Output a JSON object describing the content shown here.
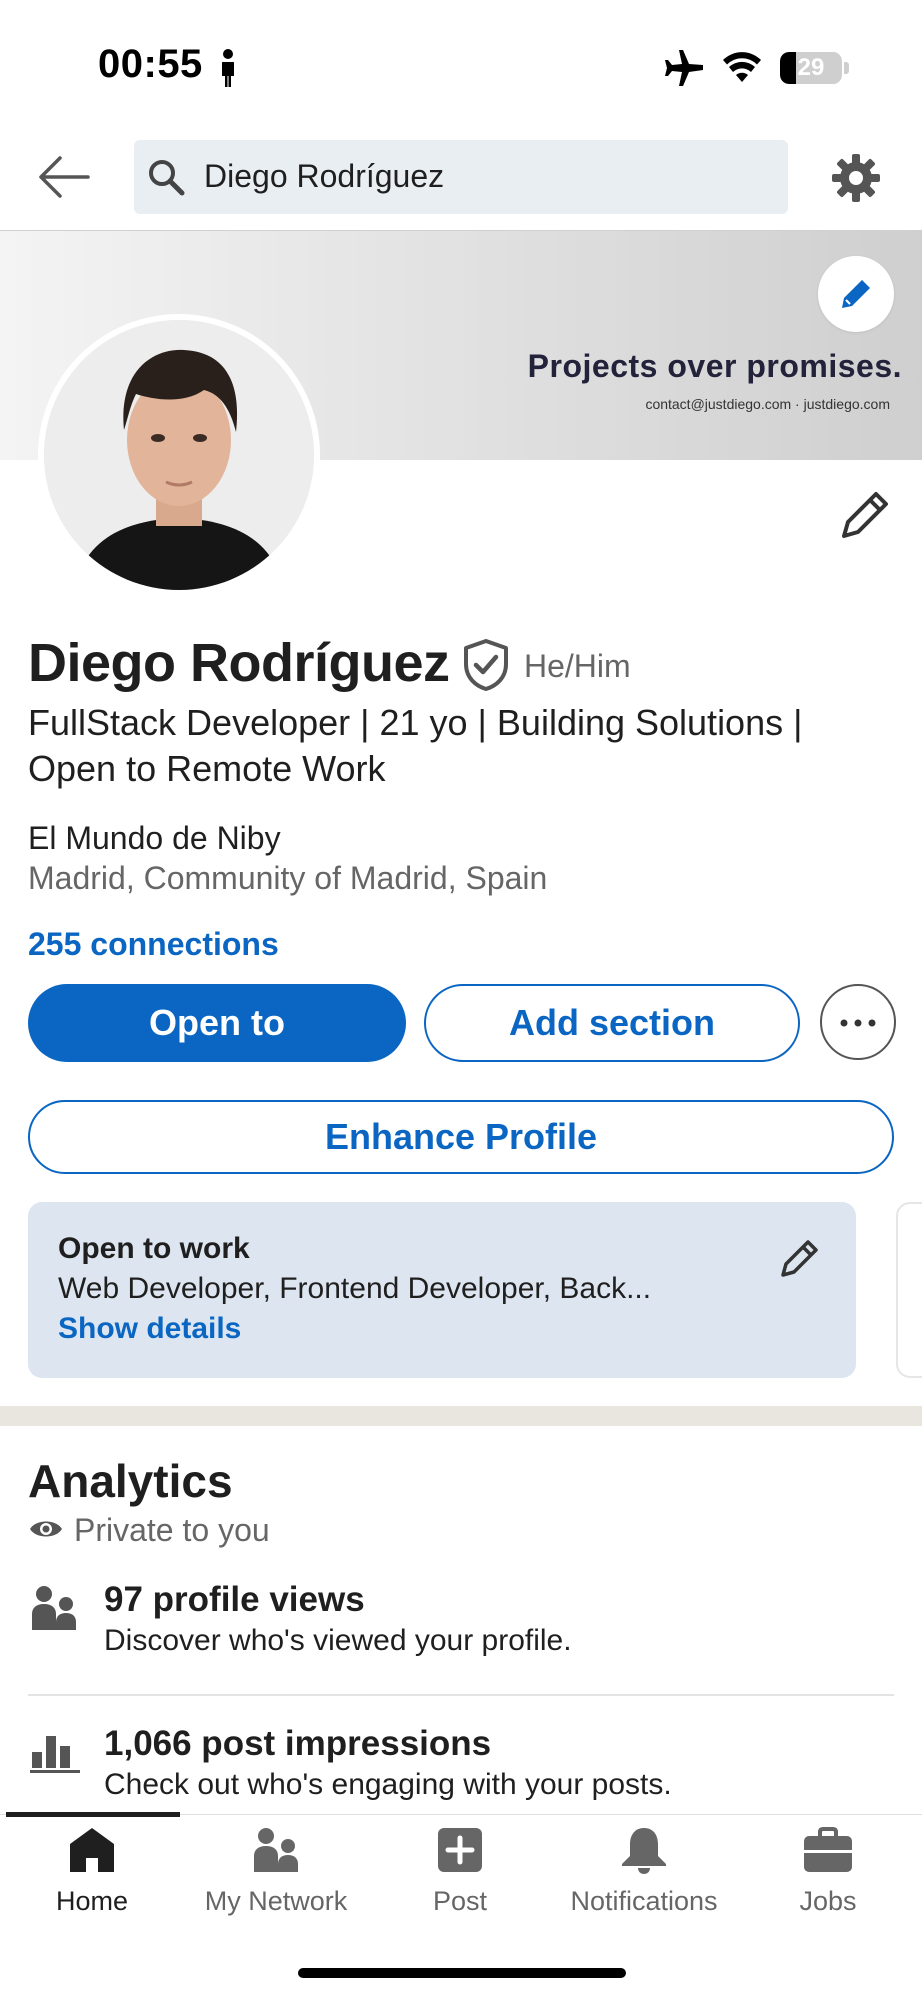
{
  "status_bar": {
    "time": "00:55",
    "battery": "29"
  },
  "search": {
    "query": "Diego Rodríguez"
  },
  "banner": {
    "headline": "Projects over promises.",
    "contact": "contact@justdiego.com · justdiego.com"
  },
  "profile": {
    "name": "Diego Rodríguez",
    "pronouns": "He/Him",
    "headline": "FullStack Developer | 21 yo | Building Solutions | Open to Remote Work",
    "company": "El Mundo de Niby",
    "location": "Madrid, Community of Madrid, Spain",
    "connections": "255 connections"
  },
  "actions": {
    "open_to": "Open to",
    "add_section": "Add section",
    "enhance_profile": "Enhance Profile"
  },
  "open_to_work": {
    "title": "Open to work",
    "roles": "Web Developer, Frontend Developer, Back...",
    "link": "Show details"
  },
  "analytics": {
    "title": "Analytics",
    "visibility": "Private to you",
    "items": [
      {
        "title": "97 profile views",
        "subtitle": "Discover who's viewed your profile."
      },
      {
        "title": "1,066 post impressions",
        "subtitle": "Check out who's engaging with your posts."
      }
    ]
  },
  "bottom_nav": {
    "items": [
      {
        "label": "Home",
        "icon": "home-icon",
        "active": true
      },
      {
        "label": "My Network",
        "icon": "network-icon",
        "active": false
      },
      {
        "label": "Post",
        "icon": "post-icon",
        "active": false
      },
      {
        "label": "Notifications",
        "icon": "bell-icon",
        "active": false
      },
      {
        "label": "Jobs",
        "icon": "briefcase-icon",
        "active": false
      }
    ]
  },
  "colors": {
    "accent": "#0a66c2",
    "card": "#dde6f0",
    "text": "#1f1f1f",
    "muted": "#666666"
  }
}
